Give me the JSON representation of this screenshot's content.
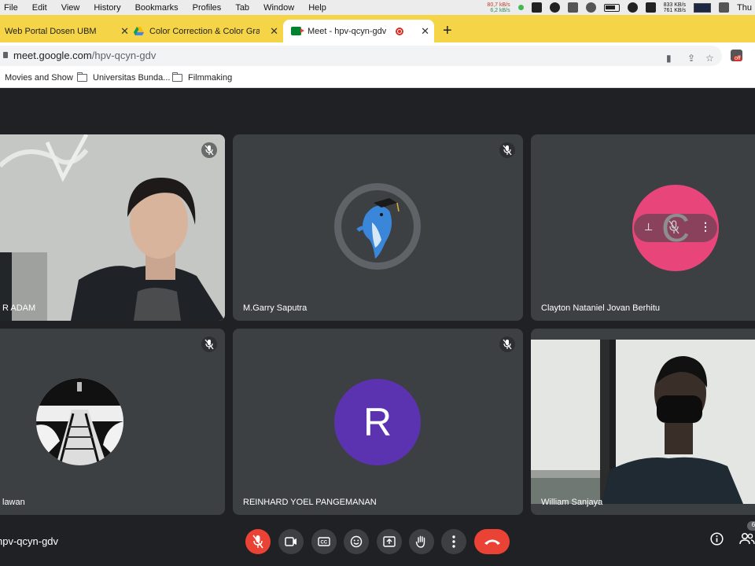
{
  "menubar": {
    "items": [
      "File",
      "Edit",
      "View",
      "History",
      "Bookmarks",
      "Profiles",
      "Tab",
      "Window",
      "Help"
    ],
    "net_up": "80,7 kB/s",
    "net_down": "6,2 kB/s",
    "net2_up": "833 KB/s",
    "net2_down": "761 KB/s",
    "clock": "Thu"
  },
  "tabs": [
    {
      "title": "Web Portal Dosen UBM",
      "active": false
    },
    {
      "title": "Color Correction & Color Grad",
      "active": false
    },
    {
      "title": "Meet - hpv-qcyn-gdv",
      "active": true
    }
  ],
  "address": {
    "domain": "meet.google.com",
    "path": "/hpv-qcyn-gdv",
    "ext_badge": "off"
  },
  "bookmarks": [
    {
      "label": "Movies and Show",
      "folder": false
    },
    {
      "label": "Universitas Bunda...",
      "folder": true
    },
    {
      "label": "Filmmaking",
      "folder": true
    }
  ],
  "participants": [
    {
      "name": "R ADAM",
      "type": "video",
      "muted": true
    },
    {
      "name": "M.Garry Saputra",
      "type": "image",
      "muted": true
    },
    {
      "name": "Clayton Nataniel Jovan Berhitu",
      "type": "letter",
      "letter": "C",
      "color": "#e8457a",
      "muted": false
    },
    {
      "name": "lawan",
      "type": "image",
      "muted": true
    },
    {
      "name": "REINHARD YOEL PANGEMANAN",
      "type": "letter",
      "letter": "R",
      "color": "#5b33b0",
      "muted": true
    },
    {
      "name": "William Sanjaya",
      "type": "video",
      "muted": false
    }
  ],
  "meeting": {
    "code": "hpv-qcyn-gdv",
    "participant_count": "6"
  },
  "controls": [
    "mic-off",
    "camera",
    "captions",
    "emoji",
    "present",
    "raise-hand",
    "more",
    "end-call"
  ],
  "colors": {
    "tab_strip": "#f5d547",
    "meet_bg": "#202124",
    "tile": "#3c4043",
    "end_call": "#ea4335"
  }
}
